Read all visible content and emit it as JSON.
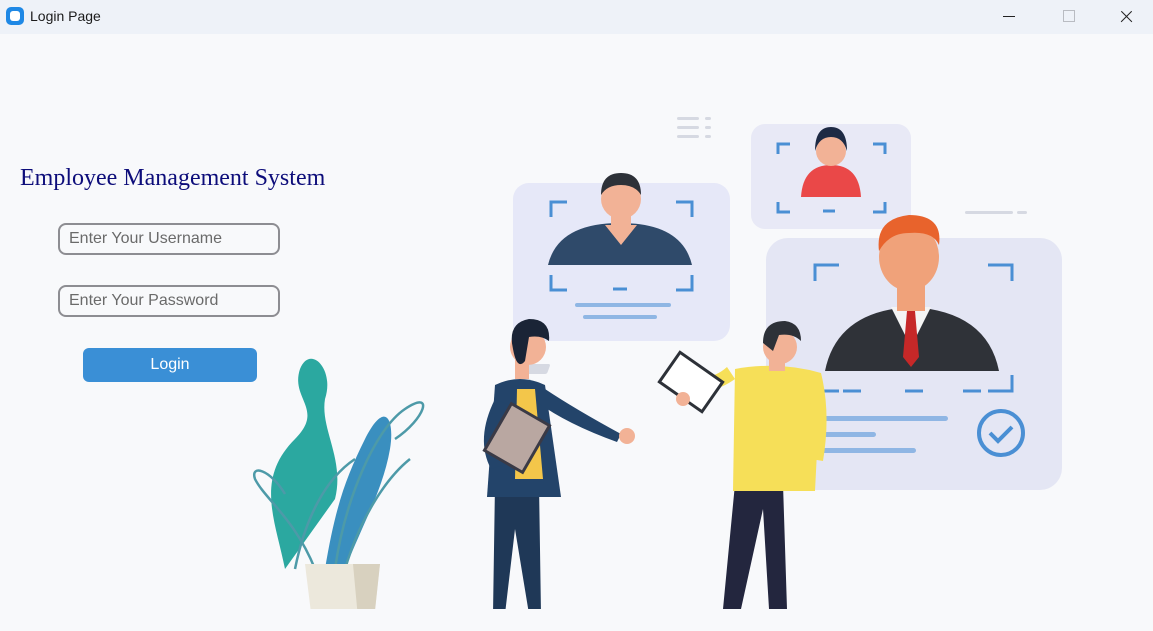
{
  "window": {
    "title": "Login Page"
  },
  "login": {
    "heading": "Employee Management System",
    "username_placeholder": "Enter Your Username",
    "username_value": "",
    "password_placeholder": "Enter Your Password",
    "password_value": "",
    "button_label": "Login"
  },
  "colors": {
    "heading": "#0d0d7a",
    "button": "#3a8fd6",
    "field_border": "#8d8d92",
    "ground": "#3e3a9e"
  },
  "icons": [
    "app-icon",
    "minimize-icon",
    "maximize-icon",
    "close-icon"
  ],
  "illustration": "employees-reviewing-profiles"
}
